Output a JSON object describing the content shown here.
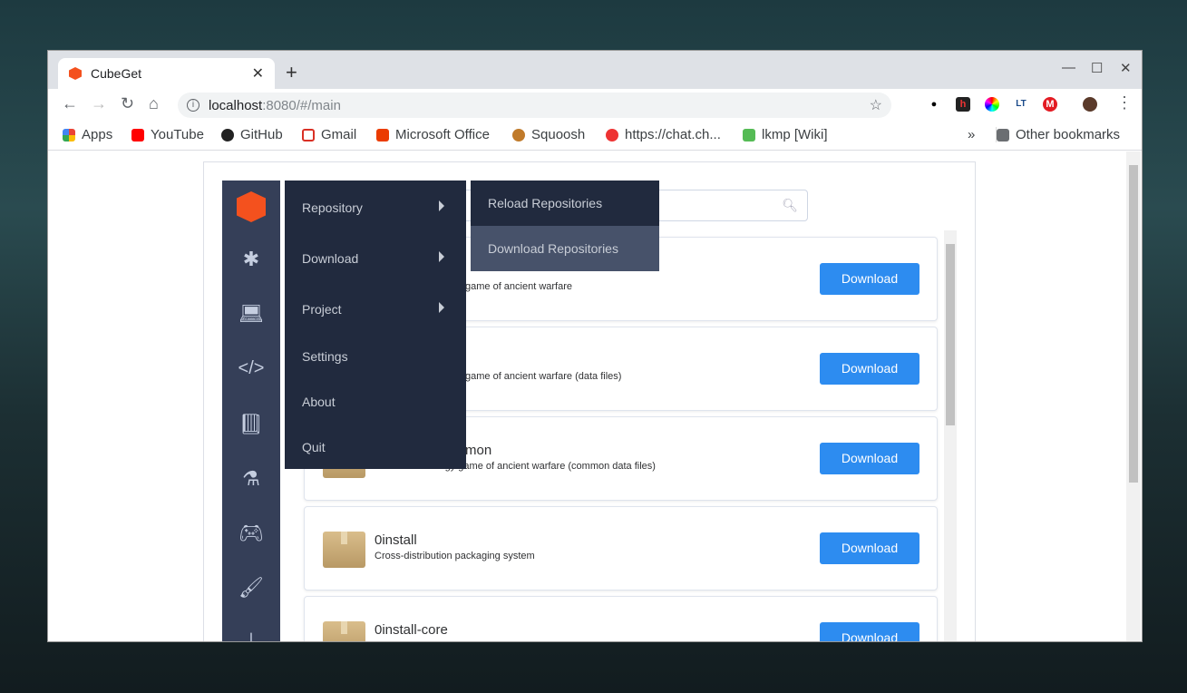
{
  "browser": {
    "tab_title": "CubeGet",
    "url_host": "localhost",
    "url_rest": ":8080/#/main",
    "bookmarks": [
      "Apps",
      "YouTube",
      "GitHub",
      "Gmail",
      "Microsoft Office",
      "Squoosh",
      "https://chat.ch...",
      "lkmp [Wiki]"
    ],
    "overflow": "»",
    "other_bookmarks": "Other bookmarks"
  },
  "app": {
    "sidebar_icons": [
      "asterisk-icon",
      "laptop-icon",
      "code-icon",
      "book-icon",
      "flask-icon",
      "gamepad-icon",
      "brush-icon",
      "puzzle-icon"
    ],
    "menu": [
      {
        "label": "Repository",
        "submenu": true
      },
      {
        "label": "Download",
        "submenu": true
      },
      {
        "label": "Project",
        "submenu": true
      },
      {
        "label": "Settings"
      },
      {
        "label": "About"
      },
      {
        "label": "Quit"
      }
    ],
    "submenu": [
      {
        "label": "Reload Repositories"
      },
      {
        "label": "Download Repositories",
        "hovered": true
      }
    ],
    "packages": [
      {
        "name": "",
        "desc": "game of ancient warfare",
        "button": "Download"
      },
      {
        "name": "",
        "desc": "game of ancient warfare (data files)",
        "button": "Download"
      },
      {
        "name": "mon",
        "desc": "Real-time strategy game of ancient warfare (common data files)",
        "button": "Download"
      },
      {
        "name": "0install",
        "desc": "Cross-distribution packaging system",
        "button": "Download"
      },
      {
        "name": "0install-core",
        "desc": "",
        "button": "Download"
      }
    ],
    "colors": {
      "sidebar": "#353f58",
      "menu": "#212a3e",
      "submenu_hover": "#47526a",
      "button": "#2d8cf0",
      "logo": "#f4511e"
    }
  }
}
